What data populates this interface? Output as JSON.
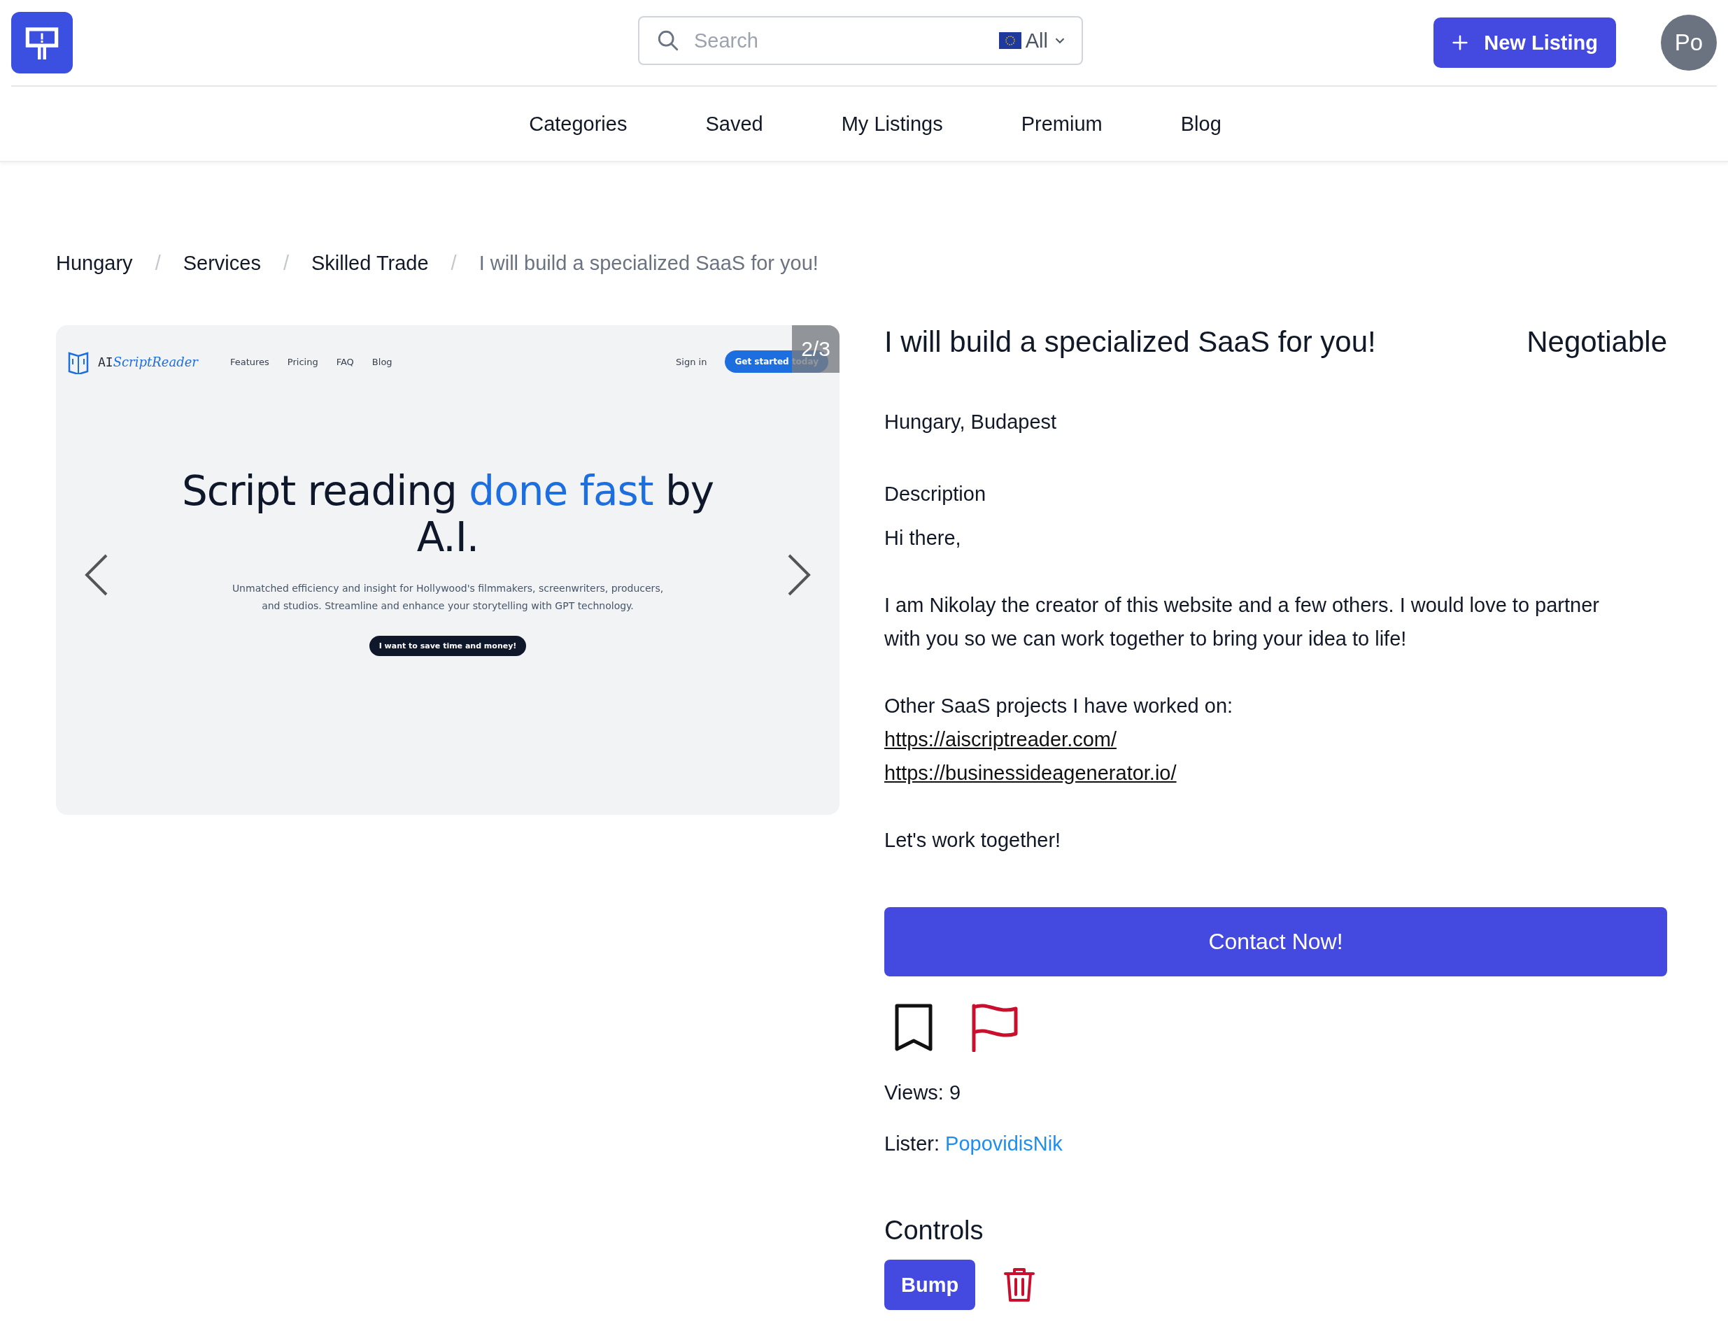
{
  "header": {
    "search": {
      "placeholder": "Search"
    },
    "region_filter": {
      "label": "All"
    },
    "new_listing_button": "New Listing",
    "avatar": "Po"
  },
  "nav": [
    "Categories",
    "Saved",
    "My Listings",
    "Premium",
    "Blog"
  ],
  "breadcrumb_separator": "/",
  "breadcrumb": [
    {
      "label": "Hungary",
      "current": false
    },
    {
      "label": "Services",
      "current": false
    },
    {
      "label": "Skilled Trade",
      "current": false
    },
    {
      "label": "I will build a specialized SaaS for you!",
      "current": true
    }
  ],
  "gallery": {
    "counter": "2/3",
    "slide": {
      "logo": {
        "prefix": "AI",
        "name": "ScriptReader"
      },
      "links": [
        "Features",
        "Pricing",
        "FAQ",
        "Blog"
      ],
      "sign_in": "Sign in",
      "cta": "Get started today",
      "headline": {
        "before": "Script reading ",
        "highlight": "done fast",
        "after": " by A.I."
      },
      "subtitle": "Unmatched efficiency and insight for Hollywood's filmmakers, screenwriters, producers, and studios. Streamline and enhance your storytelling with GPT technology.",
      "button": "I want to save time and money!"
    }
  },
  "listing": {
    "title": "I will build a specialized SaaS for you!",
    "price": "Negotiable",
    "location": "Hungary, Budapest",
    "description_heading": "Description",
    "description": [
      {
        "text": "Hi there,"
      },
      {
        "text": "I am Nikolay the creator of this website and a few others. I would love to partner with you so we can work together to bring your idea to life!"
      },
      {
        "text": "Other SaaS projects I have worked on:",
        "links": [
          "https://aiscriptreader.com/",
          "https://businessideagenerator.io/"
        ]
      },
      {
        "text": "Let's work together!"
      }
    ],
    "contact_button": "Contact Now!",
    "saved": false,
    "views": "Views: 9",
    "lister": {
      "label": "Lister:",
      "name": "PopovidisNik"
    },
    "controls": {
      "heading": "Controls",
      "bump_button": "Bump"
    }
  }
}
